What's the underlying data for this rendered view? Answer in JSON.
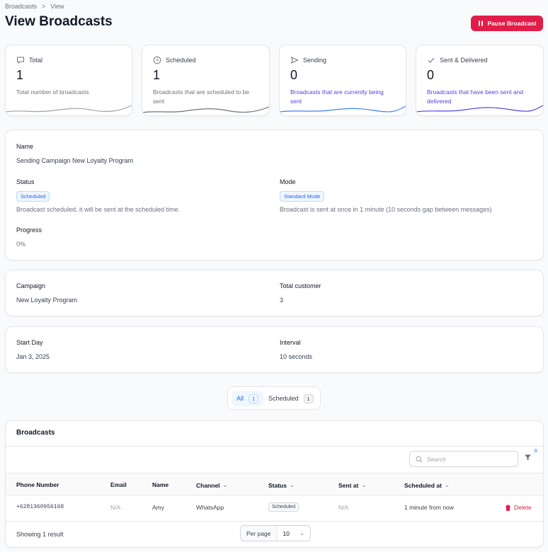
{
  "breadcrumb": {
    "items": [
      "Broadcasts",
      "View"
    ],
    "separator": ">"
  },
  "page": {
    "title": "View Broadcasts"
  },
  "actions": {
    "pause_label": "Pause Broadcast"
  },
  "stats": [
    {
      "icon": "chat-bubble-icon",
      "label": "Total",
      "value": "1",
      "description": "Total number of broadcasts",
      "color": "#9ca3af"
    },
    {
      "icon": "clock-icon",
      "label": "Scheduled",
      "value": "1",
      "description": "Broadcasts that are scheduled to be sent",
      "color": "#6b7280"
    },
    {
      "icon": "send-icon",
      "label": "Sending",
      "value": "0",
      "description": "Broadcasts that are currently being sent",
      "color": "#3b82f6"
    },
    {
      "icon": "check-icon",
      "label": "Sent & Delivered",
      "value": "0",
      "description": "Broadcasts that have been sent and delivered",
      "color": "#4f46e5"
    }
  ],
  "details": {
    "name_label": "Name",
    "name_value": "Sending Campaign New Loyalty Program",
    "status_label": "Status",
    "status_badge": "Scheduled",
    "status_desc": "Broadcast scheduled, it will be sent at the scheduled time.",
    "mode_label": "Mode",
    "mode_badge": "Standard Mode",
    "mode_desc": "Broadcast is sent at once in 1 minute (10 seconds gap between messages)",
    "progress_label": "Progress",
    "progress_value": "0%"
  },
  "campaign": {
    "campaign_label": "Campaign",
    "campaign_value": "New Loyalty Program",
    "total_label": "Total customer",
    "total_value": "3"
  },
  "schedule": {
    "start_label": "Start Day",
    "start_value": "Jan 3, 2025",
    "interval_label": "Interval",
    "interval_value": "10 seconds"
  },
  "tabs": [
    {
      "label": "All",
      "count": "1",
      "active": true
    },
    {
      "label": "Scheduled",
      "count": "1",
      "active": false
    }
  ],
  "table": {
    "heading": "Broadcasts",
    "search_placeholder": "Search",
    "filter_count": "0",
    "columns": [
      "Phone Number",
      "Email",
      "Name",
      "Channel",
      "Status",
      "Sent at",
      "Scheduled at"
    ],
    "rows": [
      {
        "phone": "+6281360956168",
        "email": "N/A",
        "name": "Amy",
        "channel": "WhatsApp",
        "status": "Scheduled",
        "sent_at": "N/A",
        "scheduled_at": "1 minute from now",
        "action": "Delete"
      }
    ],
    "footer_summary": "Showing 1 result",
    "per_page_label": "Per page",
    "per_page_value": "10"
  },
  "colors": {
    "accent": "#e11d48",
    "link": "#4f46e5",
    "badge_blue": "#2563eb"
  }
}
